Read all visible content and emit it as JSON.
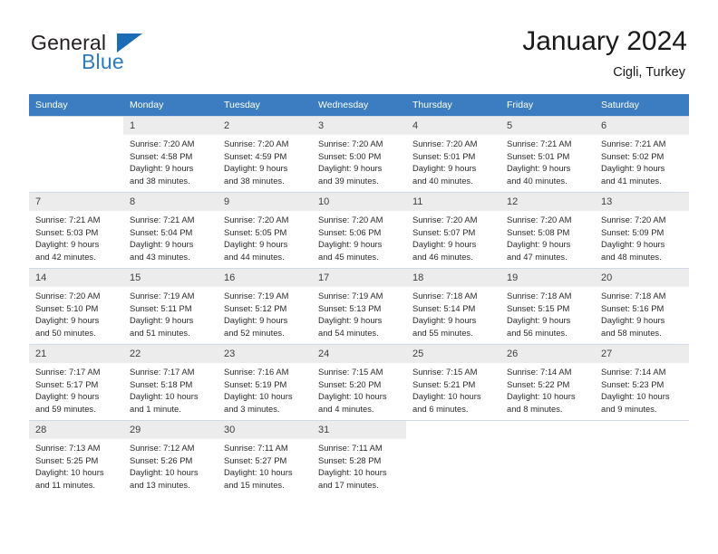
{
  "brand": {
    "name_part1": "General",
    "name_part2": "Blue",
    "triangle_color": "#1c6cb5",
    "blue_color": "#2b7cc1"
  },
  "header": {
    "title": "January 2024",
    "subtitle": "Cigli, Turkey"
  },
  "calendar": {
    "header_bg": "#3b7dc0",
    "day_headers": [
      "Sunday",
      "Monday",
      "Tuesday",
      "Wednesday",
      "Thursday",
      "Friday",
      "Saturday"
    ],
    "weeks": [
      [
        {
          "day": "",
          "sunrise": "",
          "sunset": "",
          "daylight_line1": "",
          "daylight_line2": "",
          "empty": true
        },
        {
          "day": "1",
          "sunrise": "Sunrise: 7:20 AM",
          "sunset": "Sunset: 4:58 PM",
          "daylight_line1": "Daylight: 9 hours",
          "daylight_line2": "and 38 minutes."
        },
        {
          "day": "2",
          "sunrise": "Sunrise: 7:20 AM",
          "sunset": "Sunset: 4:59 PM",
          "daylight_line1": "Daylight: 9 hours",
          "daylight_line2": "and 38 minutes."
        },
        {
          "day": "3",
          "sunrise": "Sunrise: 7:20 AM",
          "sunset": "Sunset: 5:00 PM",
          "daylight_line1": "Daylight: 9 hours",
          "daylight_line2": "and 39 minutes."
        },
        {
          "day": "4",
          "sunrise": "Sunrise: 7:20 AM",
          "sunset": "Sunset: 5:01 PM",
          "daylight_line1": "Daylight: 9 hours",
          "daylight_line2": "and 40 minutes."
        },
        {
          "day": "5",
          "sunrise": "Sunrise: 7:21 AM",
          "sunset": "Sunset: 5:01 PM",
          "daylight_line1": "Daylight: 9 hours",
          "daylight_line2": "and 40 minutes."
        },
        {
          "day": "6",
          "sunrise": "Sunrise: 7:21 AM",
          "sunset": "Sunset: 5:02 PM",
          "daylight_line1": "Daylight: 9 hours",
          "daylight_line2": "and 41 minutes."
        }
      ],
      [
        {
          "day": "7",
          "sunrise": "Sunrise: 7:21 AM",
          "sunset": "Sunset: 5:03 PM",
          "daylight_line1": "Daylight: 9 hours",
          "daylight_line2": "and 42 minutes."
        },
        {
          "day": "8",
          "sunrise": "Sunrise: 7:21 AM",
          "sunset": "Sunset: 5:04 PM",
          "daylight_line1": "Daylight: 9 hours",
          "daylight_line2": "and 43 minutes."
        },
        {
          "day": "9",
          "sunrise": "Sunrise: 7:20 AM",
          "sunset": "Sunset: 5:05 PM",
          "daylight_line1": "Daylight: 9 hours",
          "daylight_line2": "and 44 minutes."
        },
        {
          "day": "10",
          "sunrise": "Sunrise: 7:20 AM",
          "sunset": "Sunset: 5:06 PM",
          "daylight_line1": "Daylight: 9 hours",
          "daylight_line2": "and 45 minutes."
        },
        {
          "day": "11",
          "sunrise": "Sunrise: 7:20 AM",
          "sunset": "Sunset: 5:07 PM",
          "daylight_line1": "Daylight: 9 hours",
          "daylight_line2": "and 46 minutes."
        },
        {
          "day": "12",
          "sunrise": "Sunrise: 7:20 AM",
          "sunset": "Sunset: 5:08 PM",
          "daylight_line1": "Daylight: 9 hours",
          "daylight_line2": "and 47 minutes."
        },
        {
          "day": "13",
          "sunrise": "Sunrise: 7:20 AM",
          "sunset": "Sunset: 5:09 PM",
          "daylight_line1": "Daylight: 9 hours",
          "daylight_line2": "and 48 minutes."
        }
      ],
      [
        {
          "day": "14",
          "sunrise": "Sunrise: 7:20 AM",
          "sunset": "Sunset: 5:10 PM",
          "daylight_line1": "Daylight: 9 hours",
          "daylight_line2": "and 50 minutes."
        },
        {
          "day": "15",
          "sunrise": "Sunrise: 7:19 AM",
          "sunset": "Sunset: 5:11 PM",
          "daylight_line1": "Daylight: 9 hours",
          "daylight_line2": "and 51 minutes."
        },
        {
          "day": "16",
          "sunrise": "Sunrise: 7:19 AM",
          "sunset": "Sunset: 5:12 PM",
          "daylight_line1": "Daylight: 9 hours",
          "daylight_line2": "and 52 minutes."
        },
        {
          "day": "17",
          "sunrise": "Sunrise: 7:19 AM",
          "sunset": "Sunset: 5:13 PM",
          "daylight_line1": "Daylight: 9 hours",
          "daylight_line2": "and 54 minutes."
        },
        {
          "day": "18",
          "sunrise": "Sunrise: 7:18 AM",
          "sunset": "Sunset: 5:14 PM",
          "daylight_line1": "Daylight: 9 hours",
          "daylight_line2": "and 55 minutes."
        },
        {
          "day": "19",
          "sunrise": "Sunrise: 7:18 AM",
          "sunset": "Sunset: 5:15 PM",
          "daylight_line1": "Daylight: 9 hours",
          "daylight_line2": "and 56 minutes."
        },
        {
          "day": "20",
          "sunrise": "Sunrise: 7:18 AM",
          "sunset": "Sunset: 5:16 PM",
          "daylight_line1": "Daylight: 9 hours",
          "daylight_line2": "and 58 minutes."
        }
      ],
      [
        {
          "day": "21",
          "sunrise": "Sunrise: 7:17 AM",
          "sunset": "Sunset: 5:17 PM",
          "daylight_line1": "Daylight: 9 hours",
          "daylight_line2": "and 59 minutes."
        },
        {
          "day": "22",
          "sunrise": "Sunrise: 7:17 AM",
          "sunset": "Sunset: 5:18 PM",
          "daylight_line1": "Daylight: 10 hours",
          "daylight_line2": "and 1 minute."
        },
        {
          "day": "23",
          "sunrise": "Sunrise: 7:16 AM",
          "sunset": "Sunset: 5:19 PM",
          "daylight_line1": "Daylight: 10 hours",
          "daylight_line2": "and 3 minutes."
        },
        {
          "day": "24",
          "sunrise": "Sunrise: 7:15 AM",
          "sunset": "Sunset: 5:20 PM",
          "daylight_line1": "Daylight: 10 hours",
          "daylight_line2": "and 4 minutes."
        },
        {
          "day": "25",
          "sunrise": "Sunrise: 7:15 AM",
          "sunset": "Sunset: 5:21 PM",
          "daylight_line1": "Daylight: 10 hours",
          "daylight_line2": "and 6 minutes."
        },
        {
          "day": "26",
          "sunrise": "Sunrise: 7:14 AM",
          "sunset": "Sunset: 5:22 PM",
          "daylight_line1": "Daylight: 10 hours",
          "daylight_line2": "and 8 minutes."
        },
        {
          "day": "27",
          "sunrise": "Sunrise: 7:14 AM",
          "sunset": "Sunset: 5:23 PM",
          "daylight_line1": "Daylight: 10 hours",
          "daylight_line2": "and 9 minutes."
        }
      ],
      [
        {
          "day": "28",
          "sunrise": "Sunrise: 7:13 AM",
          "sunset": "Sunset: 5:25 PM",
          "daylight_line1": "Daylight: 10 hours",
          "daylight_line2": "and 11 minutes."
        },
        {
          "day": "29",
          "sunrise": "Sunrise: 7:12 AM",
          "sunset": "Sunset: 5:26 PM",
          "daylight_line1": "Daylight: 10 hours",
          "daylight_line2": "and 13 minutes."
        },
        {
          "day": "30",
          "sunrise": "Sunrise: 7:11 AM",
          "sunset": "Sunset: 5:27 PM",
          "daylight_line1": "Daylight: 10 hours",
          "daylight_line2": "and 15 minutes."
        },
        {
          "day": "31",
          "sunrise": "Sunrise: 7:11 AM",
          "sunset": "Sunset: 5:28 PM",
          "daylight_line1": "Daylight: 10 hours",
          "daylight_line2": "and 17 minutes."
        },
        {
          "day": "",
          "sunrise": "",
          "sunset": "",
          "daylight_line1": "",
          "daylight_line2": "",
          "empty": true
        },
        {
          "day": "",
          "sunrise": "",
          "sunset": "",
          "daylight_line1": "",
          "daylight_line2": "",
          "empty": true
        },
        {
          "day": "",
          "sunrise": "",
          "sunset": "",
          "daylight_line1": "",
          "daylight_line2": "",
          "empty": true
        }
      ]
    ]
  }
}
